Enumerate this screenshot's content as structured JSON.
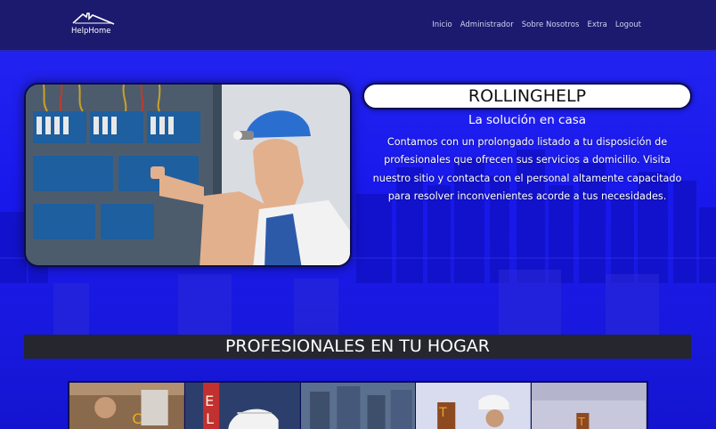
{
  "navbar": {
    "brand": "HelpHome",
    "links": [
      "Inicio",
      "Administrador",
      "Sobre Nosotros",
      "Extra",
      "Logout"
    ]
  },
  "hero": {
    "title": "ROLLINGHELP",
    "tagline": "La solución en casa",
    "description": "Contamos con un prolongado listado a tu disposición de profesionales que ofrecen sus servicios a domicilio. Visita nuestro sitio y contacta con el personal altamente capacitado para resolver inconvenientes acorde a tus necesidades."
  },
  "section": {
    "title": "PROFESIONALES EN TU HOGAR"
  },
  "icons": {
    "logo": "house-roof-icon"
  },
  "colors": {
    "navbar": "#1b1a6e",
    "background": "#1e1ee8",
    "section_bar": "#25262e"
  }
}
